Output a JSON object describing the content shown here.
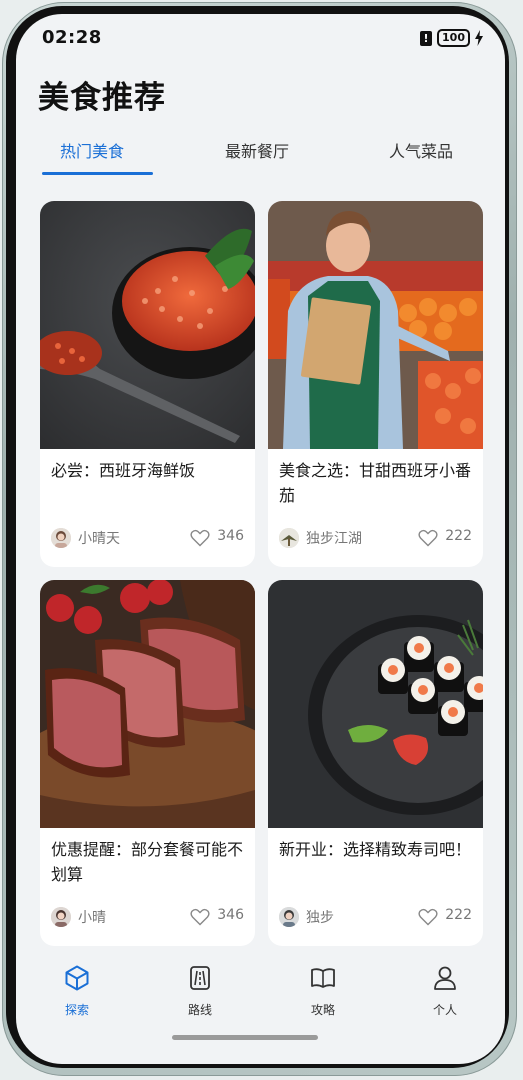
{
  "status_bar": {
    "time": "02:28",
    "alert_glyph": "!",
    "battery": "100"
  },
  "page": {
    "title": "美食推荐"
  },
  "tabs": [
    {
      "label": "热门美食",
      "active": true
    },
    {
      "label": "最新餐厅",
      "active": false
    },
    {
      "label": "人气菜品",
      "active": false
    }
  ],
  "cards": [
    {
      "title": "必尝：西班牙海鲜饭",
      "author": "小晴天",
      "likes": "346",
      "image": "salmon-roe-bowl"
    },
    {
      "title": "美食之选：甘甜西班牙小番茄",
      "author": "独步江湖",
      "likes": "222",
      "image": "grocer-with-tomatoes"
    },
    {
      "title": "优惠提醒：部分套餐可能不划算",
      "author": "小晴",
      "likes": "346",
      "image": "sliced-steak"
    },
    {
      "title": "新开业：选择精致寿司吧！",
      "author": "独步",
      "likes": "222",
      "image": "sushi-plate"
    }
  ],
  "bottom_nav": [
    {
      "label": "探索",
      "icon": "cube-icon",
      "active": true
    },
    {
      "label": "路线",
      "icon": "road-icon",
      "active": false
    },
    {
      "label": "攻略",
      "icon": "book-icon",
      "active": false
    },
    {
      "label": "个人",
      "icon": "person-icon",
      "active": false
    }
  ],
  "colors": {
    "accent": "#1a6fd6",
    "background": "#f1f3f5",
    "card": "#ffffff"
  }
}
